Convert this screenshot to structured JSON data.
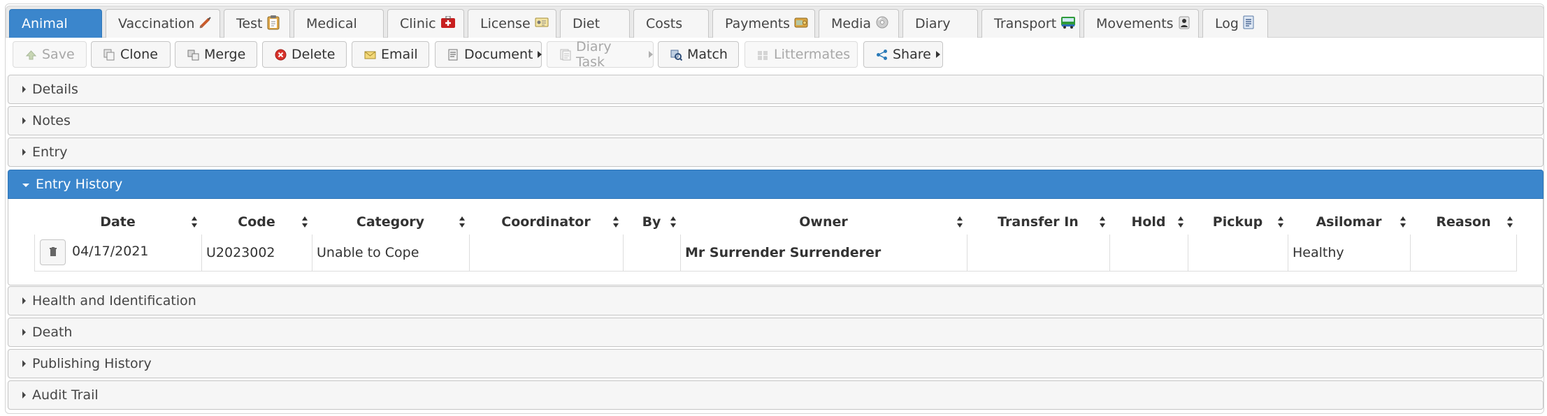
{
  "tabs": [
    {
      "label": "Animal",
      "icon": null,
      "active": true
    },
    {
      "label": "Vaccination",
      "icon": "syringe-icon"
    },
    {
      "label": "Test",
      "icon": "clipboard-icon"
    },
    {
      "label": "Medical",
      "icon": null
    },
    {
      "label": "Clinic",
      "icon": "first-aid-kit-icon"
    },
    {
      "label": "License",
      "icon": "license-card-icon"
    },
    {
      "label": "Diet",
      "icon": null
    },
    {
      "label": "Costs",
      "icon": null
    },
    {
      "label": "Payments",
      "icon": "payments-icon"
    },
    {
      "label": "Media",
      "icon": "media-disc-icon"
    },
    {
      "label": "Diary",
      "icon": null
    },
    {
      "label": "Transport",
      "icon": "van-icon"
    },
    {
      "label": "Movements",
      "icon": "person-icon"
    },
    {
      "label": "Log",
      "icon": "log-icon"
    }
  ],
  "toolbar": {
    "save": "Save",
    "clone": "Clone",
    "merge": "Merge",
    "delete": "Delete",
    "email": "Email",
    "document": "Document",
    "diary_task": "Diary Task",
    "match": "Match",
    "littermates": "Littermates",
    "share": "Share"
  },
  "sections": {
    "details": "Details",
    "notes": "Notes",
    "entry": "Entry",
    "entry_history": "Entry History",
    "health": "Health and Identification",
    "death": "Death",
    "publishing": "Publishing History",
    "audit": "Audit Trail"
  },
  "entry_history": {
    "columns": [
      "Date",
      "Code",
      "Category",
      "Coordinator",
      "By",
      "Owner",
      "Transfer In",
      "Hold",
      "Pickup",
      "Asilomar",
      "Reason"
    ],
    "rows": [
      {
        "date": "04/17/2021",
        "code": "U2023002",
        "category": "Unable to Cope",
        "coordinator": "",
        "by": "",
        "owner": "Mr Surrender Surrenderer",
        "transfer_in": "",
        "hold": "",
        "pickup": "",
        "asilomar": "Healthy",
        "reason": ""
      }
    ]
  },
  "colors": {
    "accent": "#3b86cc",
    "delete_red": "#d9322b",
    "share_blue": "#2a7ab8"
  }
}
